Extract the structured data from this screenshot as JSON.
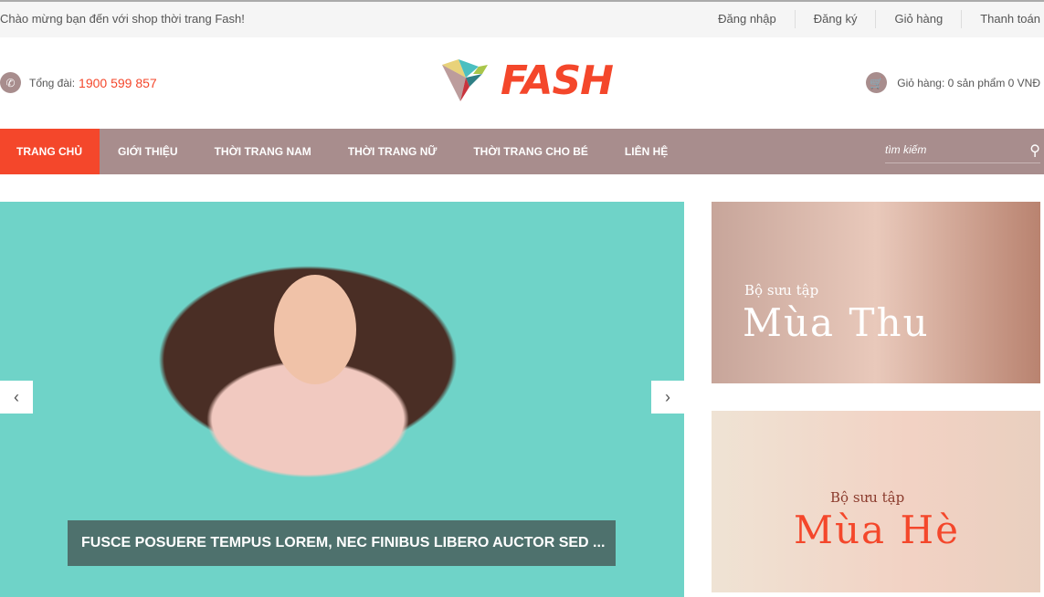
{
  "topbar": {
    "welcome": "Chào mừng bạn đến với shop thời trang Fash!",
    "links": [
      "Đăng nhập",
      "Đăng ký",
      "Giỏ hàng",
      "Thanh toán"
    ]
  },
  "header": {
    "phone_label": "Tổng đài:",
    "phone_number": "1900 599 857",
    "logo_text": "FASH",
    "cart_text": "Giỏ hàng: 0 sản phẩm 0 VNĐ"
  },
  "nav": {
    "items": [
      "TRANG CHỦ",
      "GIỚI THIỆU",
      "THỜI TRANG NAM",
      "THỜI TRANG NỮ",
      "THỜI TRANG CHO BÉ",
      "LIÊN HỆ"
    ],
    "search_placeholder": "tìm kiếm"
  },
  "slider": {
    "caption": "FUSCE POSUERE TEMPUS LOREM, NEC FINIBUS LIBERO AUCTOR SED ...",
    "prev": "‹",
    "next": "›"
  },
  "banners": [
    {
      "small": "Bộ sưu tập",
      "big": "Mùa Thu"
    },
    {
      "small": "Bộ sưu tập",
      "big": "Mùa Hè"
    }
  ],
  "colors": {
    "accent": "#f4472b",
    "nav_bg": "#a88d8d",
    "topbar_bg": "#f5f5f5"
  }
}
